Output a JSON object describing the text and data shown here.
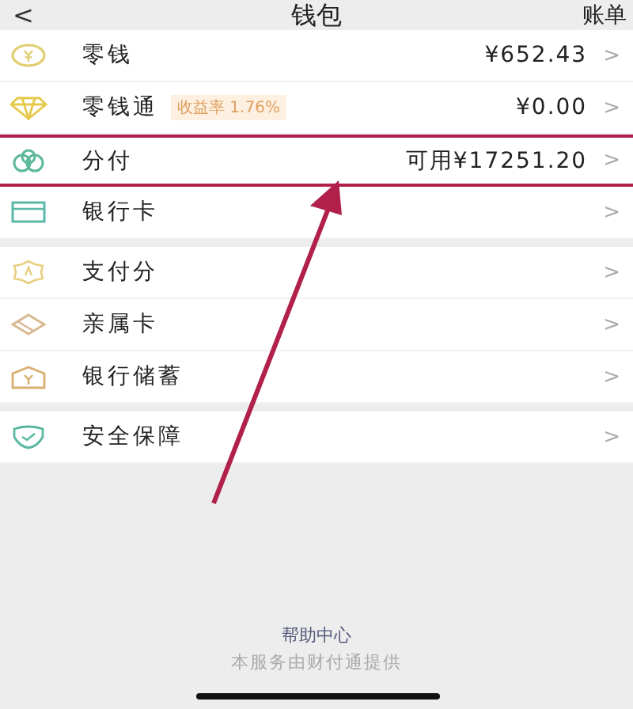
{
  "header": {
    "back": "<",
    "title": "钱包",
    "action": "账单"
  },
  "groups": [
    {
      "items": [
        {
          "label": "零钱",
          "value": "¥652.43",
          "chevron": ">",
          "highlighted": false
        },
        {
          "label": "零钱通",
          "badge": "收益率 1.76%",
          "value": "¥0.00",
          "chevron": ">",
          "highlighted": false
        },
        {
          "label": "分付",
          "value": "可用¥17251.20",
          "chevron": ">",
          "highlighted": true
        },
        {
          "label": "银行卡",
          "chevron": ">",
          "highlighted": false
        }
      ]
    },
    {
      "items": [
        {
          "label": "支付分",
          "chevron": ">",
          "highlighted": false
        },
        {
          "label": "亲属卡",
          "chevron": ">",
          "highlighted": false
        },
        {
          "label": "银行储蓄",
          "chevron": ">",
          "highlighted": false
        }
      ]
    },
    {
      "items": [
        {
          "label": "安全保障",
          "chevron": ">",
          "highlighted": false
        }
      ]
    }
  ],
  "footer": {
    "link": "帮助中心",
    "note": "本服务由财付通提供"
  }
}
